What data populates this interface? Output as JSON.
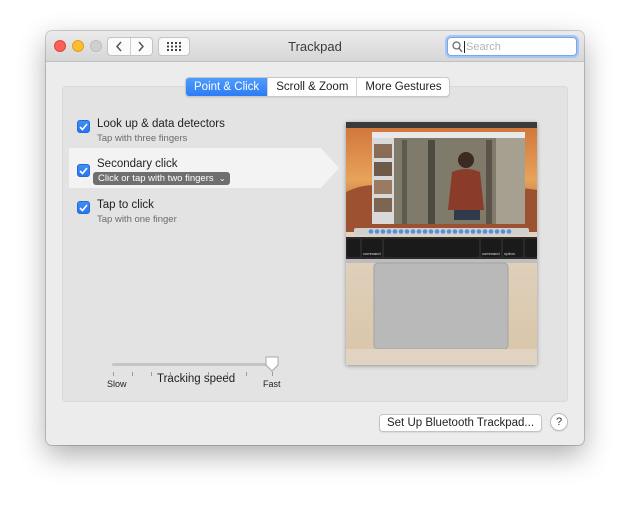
{
  "window": {
    "title": "Trackpad"
  },
  "toolbar": {
    "back_icon": "chevron-left-icon",
    "forward_icon": "chevron-right-icon",
    "grid_icon": "grid-icon"
  },
  "search": {
    "placeholder": "Search",
    "icon": "magnifier-icon"
  },
  "tabs": [
    {
      "label": "Point & Click",
      "active": true
    },
    {
      "label": "Scroll & Zoom",
      "active": false
    },
    {
      "label": "More Gestures",
      "active": false
    }
  ],
  "options": [
    {
      "title": "Look up & data detectors",
      "subtitle": "Tap with three fingers",
      "checked": true
    },
    {
      "title": "Secondary click",
      "subtitle": "Click or tap with two fingers",
      "checked": true
    },
    {
      "title": "Tap to click",
      "subtitle": "Tap with one finger",
      "checked": true
    }
  ],
  "tracking": {
    "label": "Tracking speed",
    "min_label": "Slow",
    "max_label": "Fast",
    "value": 1.0
  },
  "preview": {
    "keys": {
      "left_command": "command",
      "right_command": "command",
      "right_option": "option"
    }
  },
  "footer": {
    "bluetooth_button": "Set Up Bluetooth Trackpad...",
    "help_button": "?"
  },
  "colors": {
    "accent": "#2e7cf6",
    "checkbox": "#3f8ef8",
    "close": "#fe5f57",
    "minimize": "#febc2e"
  }
}
